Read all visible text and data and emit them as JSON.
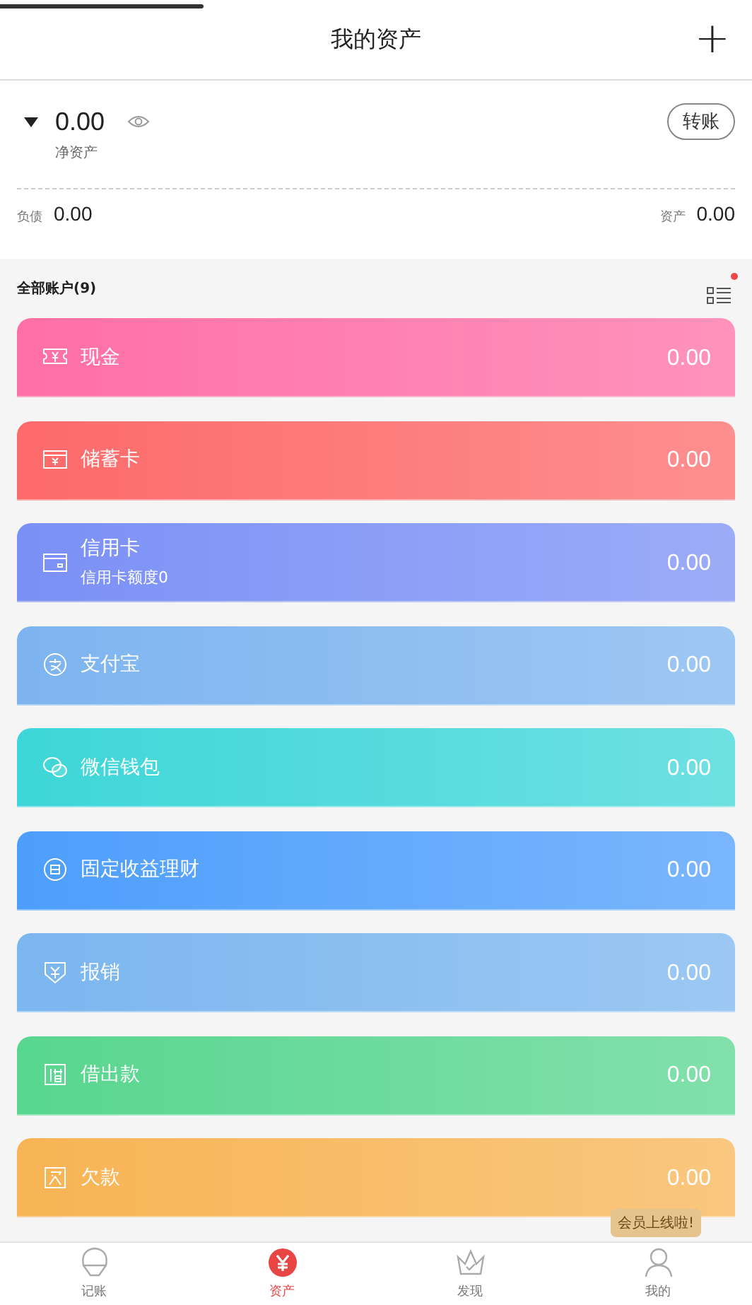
{
  "top_progress": {
    "level": 0.27
  },
  "header": {
    "title": "我的资产",
    "add_button": "+"
  },
  "summary": {
    "net_value": "0.00",
    "net_label": "净资产",
    "transfer_button": "转账",
    "liabilities_label": "负债",
    "liabilities_value": "0.00",
    "assets_label": "资产",
    "assets_value": "0.00"
  },
  "accounts_header": {
    "title": "全部账户(9)",
    "has_notification": true
  },
  "accounts": [
    {
      "name": "现金",
      "amount": "0.00",
      "color": "#ff6fa6"
    },
    {
      "name": "储蓄卡",
      "amount": "0.00",
      "color": "#fd6a6a"
    },
    {
      "name": "信用卡",
      "subtitle": "信用卡额度0",
      "amount": "0.00",
      "color": "#7b90f6"
    },
    {
      "name": "支付宝",
      "amount": "0.00",
      "color": "#7db4ef"
    },
    {
      "name": "微信钱包",
      "amount": "0.00",
      "color": "#3dd6d8"
    },
    {
      "name": "固定收益理财",
      "amount": "0.00",
      "color": "#4d9efc"
    },
    {
      "name": "报销",
      "amount": "0.00",
      "color": "#7bb6ef"
    },
    {
      "name": "借出款",
      "amount": "0.00",
      "color": "#58d68f"
    },
    {
      "name": "欠款",
      "amount": "0.00",
      "color": "#f7b454"
    }
  ],
  "tooltip": "会员上线啦!",
  "tabs": [
    {
      "label": "记账",
      "selected": false
    },
    {
      "label": "资产",
      "selected": true
    },
    {
      "label": "发现",
      "selected": false
    },
    {
      "label": "我的",
      "selected": false
    }
  ]
}
